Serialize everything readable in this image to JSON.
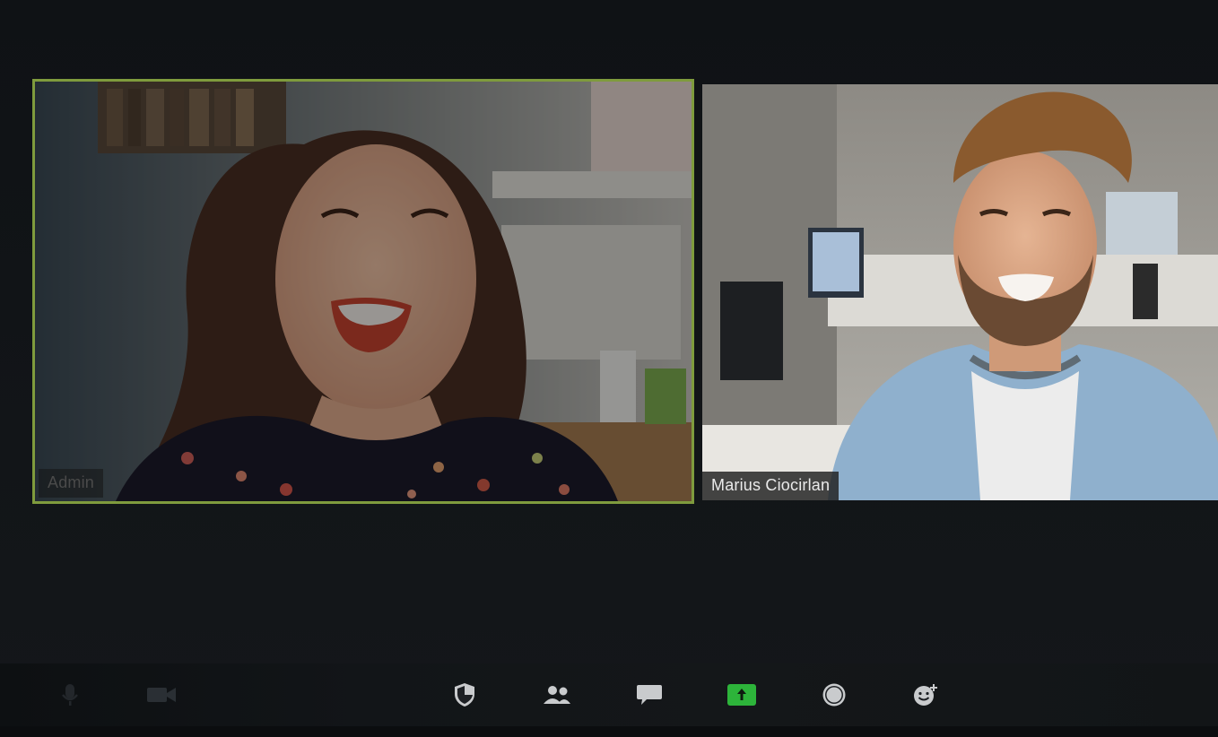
{
  "meeting": {
    "participants": [
      {
        "name": "Admin",
        "active_speaker": true
      },
      {
        "name": "Marius Ciocirlan",
        "active_speaker": false
      }
    ]
  },
  "toolbar": {
    "items": [
      {
        "icon": "microphone-icon",
        "disabled": true
      },
      {
        "icon": "video-camera-icon",
        "disabled": true
      },
      {
        "icon": "security-shield-icon"
      },
      {
        "icon": "participants-icon"
      },
      {
        "icon": "chat-icon"
      },
      {
        "icon": "share-screen-icon",
        "accent": "#2db43a"
      },
      {
        "icon": "record-icon"
      },
      {
        "icon": "reactions-icon"
      }
    ]
  },
  "colors": {
    "active_speaker_border": "#7f9b3d",
    "share_button": "#2db43a",
    "background": "#111417"
  }
}
